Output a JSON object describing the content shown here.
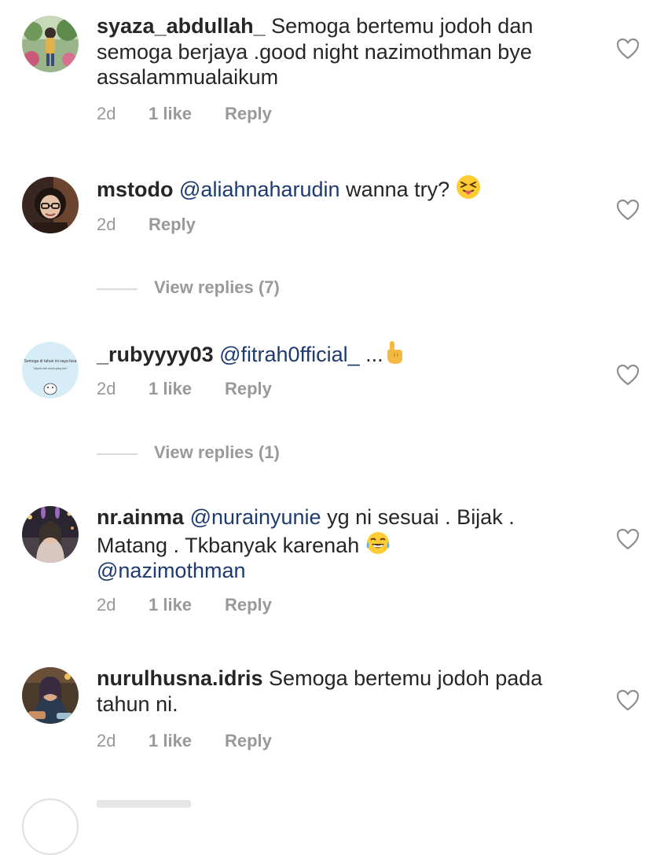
{
  "comments": [
    {
      "username": "syaza_abdullah_",
      "text_lines": [
        "Semoga bertemu jodoh dan",
        "semoga berjaya .good night nazimothman bye",
        "assalammualaikum"
      ],
      "time": "2d",
      "likes": "1 like",
      "reply": "Reply"
    },
    {
      "username": "mstodo",
      "mention": "@aliahnaharudin",
      "text": "wanna try?",
      "emoji": "squinting-face-tongue",
      "time": "2d",
      "reply": "Reply",
      "view_replies": "View replies (7)"
    },
    {
      "username": "_rubyyyy03",
      "mention": "@fitrah0fficial_",
      "text": "...",
      "emoji": "pointing-up-hand",
      "avatar_text_top": "Semoga di tahun ini saya bisa",
      "avatar_text_bottom": "\"dijauhi dari dunia yang lalu\"",
      "time": "2d",
      "likes": "1 like",
      "reply": "Reply",
      "view_replies": "View replies (1)"
    },
    {
      "username": "nr.ainma",
      "mention": "@nurainyunie",
      "text": "yg ni sesuai . Bijak .",
      "text2": "Matang . Tkbanyak karenah",
      "emoji": "tears-of-joy",
      "mention2": "@nazimothman",
      "time": "2d",
      "likes": "1 like",
      "reply": "Reply"
    },
    {
      "username": "nurulhusna.idris",
      "text": "Semoga bertemu jodoh pada",
      "text2": "tahun ni.",
      "time": "2d",
      "likes": "1 like",
      "reply": "Reply"
    }
  ],
  "colors": {
    "text": "#262626",
    "meta": "#999999",
    "mention": "#1d3b6f",
    "heart": "#8e8e8e"
  }
}
